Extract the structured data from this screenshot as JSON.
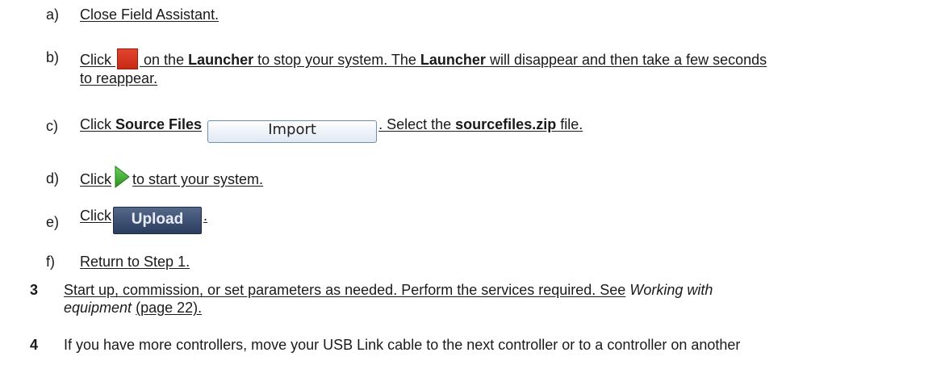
{
  "steps_sub": [
    {
      "letter": "a)",
      "text": "Close Field Assistant."
    },
    {
      "letter": "b)",
      "pre": "Click",
      "mid1": "on the",
      "bold1": "Launcher",
      "mid2": "to stop your system. The",
      "bold2": "Launcher",
      "line1_end": "will disappear and then take a few seconds",
      "line2": "to reappear."
    },
    {
      "letter": "c)",
      "pre": "Click",
      "bold1": "Source Files",
      "button": "Import",
      "mid": ". Select the",
      "bold2": "sourcefiles.zip",
      "end": "file."
    },
    {
      "letter": "d)",
      "pre": "Click",
      "end": "to start your system."
    },
    {
      "letter": "e)",
      "pre": "Click",
      "button": "Upload",
      "end": "."
    },
    {
      "letter": "f)",
      "text": "Return to Step 1."
    }
  ],
  "steps_num": [
    {
      "num": "3",
      "line1": "Start up, commission, or set parameters as needed. Perform the services required. See",
      "italic1": "Working with",
      "italic2": "equipment",
      "line2_end": "(page 22)."
    },
    {
      "num": "4",
      "line1": "If you have more controllers, move your USB Link cable to the next controller or to a controller on another"
    }
  ],
  "icons": {
    "stop": "stop-icon",
    "play": "play-icon"
  },
  "colors": {
    "stop_red": "#d2351f",
    "play_green": "#3aa52c",
    "upload_bg": "#3b4d6e"
  }
}
